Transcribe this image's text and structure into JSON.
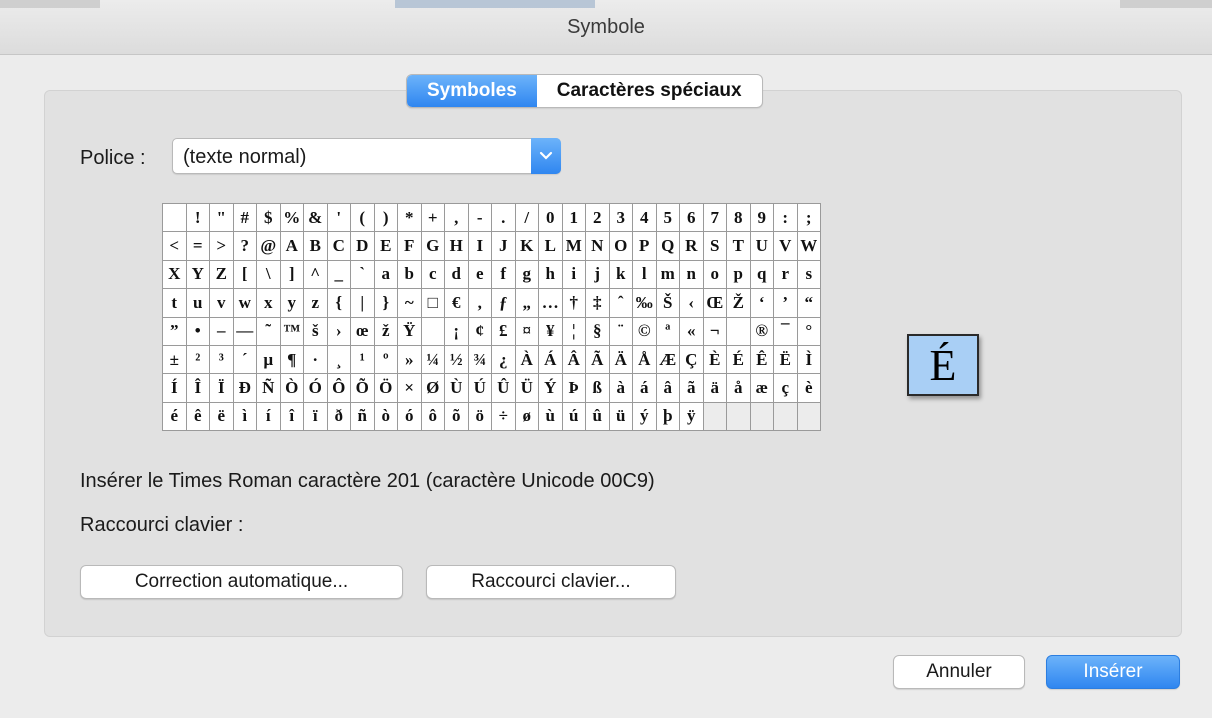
{
  "window": {
    "title": "Symbole"
  },
  "tabs": [
    {
      "label": "Symboles",
      "active": true
    },
    {
      "label": "Caractères spéciaux",
      "active": false
    }
  ],
  "font": {
    "label": "Police :",
    "value": "(texte normal)"
  },
  "grid": {
    "rows": [
      [
        " ",
        "!",
        "\"",
        "#",
        "$",
        "%",
        "&",
        "'",
        "(",
        ")",
        "*",
        "+",
        ",",
        "-",
        ".",
        "/",
        "0",
        "1",
        "2",
        "3",
        "4",
        "5",
        "6",
        "7",
        "8",
        "9",
        ":",
        ";"
      ],
      [
        "<",
        "=",
        ">",
        "?",
        "@",
        "A",
        "B",
        "C",
        "D",
        "E",
        "F",
        "G",
        "H",
        "I",
        "J",
        "K",
        "L",
        "M",
        "N",
        "O",
        "P",
        "Q",
        "R",
        "S",
        "T",
        "U",
        "V",
        "W"
      ],
      [
        "X",
        "Y",
        "Z",
        "[",
        "\\",
        "]",
        "^",
        "_",
        "`",
        "a",
        "b",
        "c",
        "d",
        "e",
        "f",
        "g",
        "h",
        "i",
        "j",
        "k",
        "l",
        "m",
        "n",
        "o",
        "p",
        "q",
        "r",
        "s"
      ],
      [
        "t",
        "u",
        "v",
        "w",
        "x",
        "y",
        "z",
        "{",
        "|",
        "}",
        "~",
        "□",
        "€",
        ",",
        "ƒ",
        "„",
        "…",
        "†",
        "‡",
        "ˆ",
        "‰",
        "Š",
        "‹",
        "Œ",
        "Ž",
        "‘",
        "’",
        "“"
      ],
      [
        "”",
        "•",
        "–",
        "—",
        "˜",
        "™",
        "š",
        "›",
        "œ",
        "ž",
        "Ÿ",
        "",
        "¡",
        "¢",
        "£",
        "¤",
        "¥",
        "¦",
        "§",
        "¨",
        "©",
        "ª",
        "«",
        "¬",
        "",
        "®",
        "¯",
        "°"
      ],
      [
        "±",
        "²",
        "³",
        "´",
        "µ",
        "¶",
        "·",
        "¸",
        "¹",
        "º",
        "»",
        "¼",
        "½",
        "¾",
        "¿",
        "À",
        "Á",
        "Â",
        "Ã",
        "Ä",
        "Å",
        "Æ",
        "Ç",
        "È",
        "É",
        "Ê",
        "Ë",
        "Ì"
      ],
      [
        "Í",
        "Î",
        "Ï",
        "Ð",
        "Ñ",
        "Ò",
        "Ó",
        "Ô",
        "Õ",
        "Ö",
        "×",
        "Ø",
        "Ù",
        "Ú",
        "Û",
        "Ü",
        "Ý",
        "Þ",
        "ß",
        "à",
        "á",
        "â",
        "ã",
        "ä",
        "å",
        "æ",
        "ç",
        "è"
      ],
      [
        "é",
        "ê",
        "ë",
        "ì",
        "í",
        "î",
        "ï",
        "ð",
        "ñ",
        "ò",
        "ó",
        "ô",
        "õ",
        "ö",
        "÷",
        "ø",
        "ù",
        "ú",
        "û",
        "ü",
        "ý",
        "þ",
        "ÿ",
        "",
        "",
        "",
        "",
        ""
      ]
    ],
    "selected_char": "É"
  },
  "info": {
    "insert_text": "Insérer le Times Roman caractère 201 (caractère Unicode 00C9)",
    "shortcut_label": "Raccourci clavier :"
  },
  "buttons": {
    "autocorrect": "Correction automatique...",
    "keyboard_shortcut": "Raccourci clavier...",
    "cancel": "Annuler",
    "insert": "Insérer"
  },
  "icons": {
    "dropdown": "chevron-down-icon"
  },
  "colors": {
    "accent": "#2f86f0",
    "magnifier_bg": "#a9cff5"
  }
}
